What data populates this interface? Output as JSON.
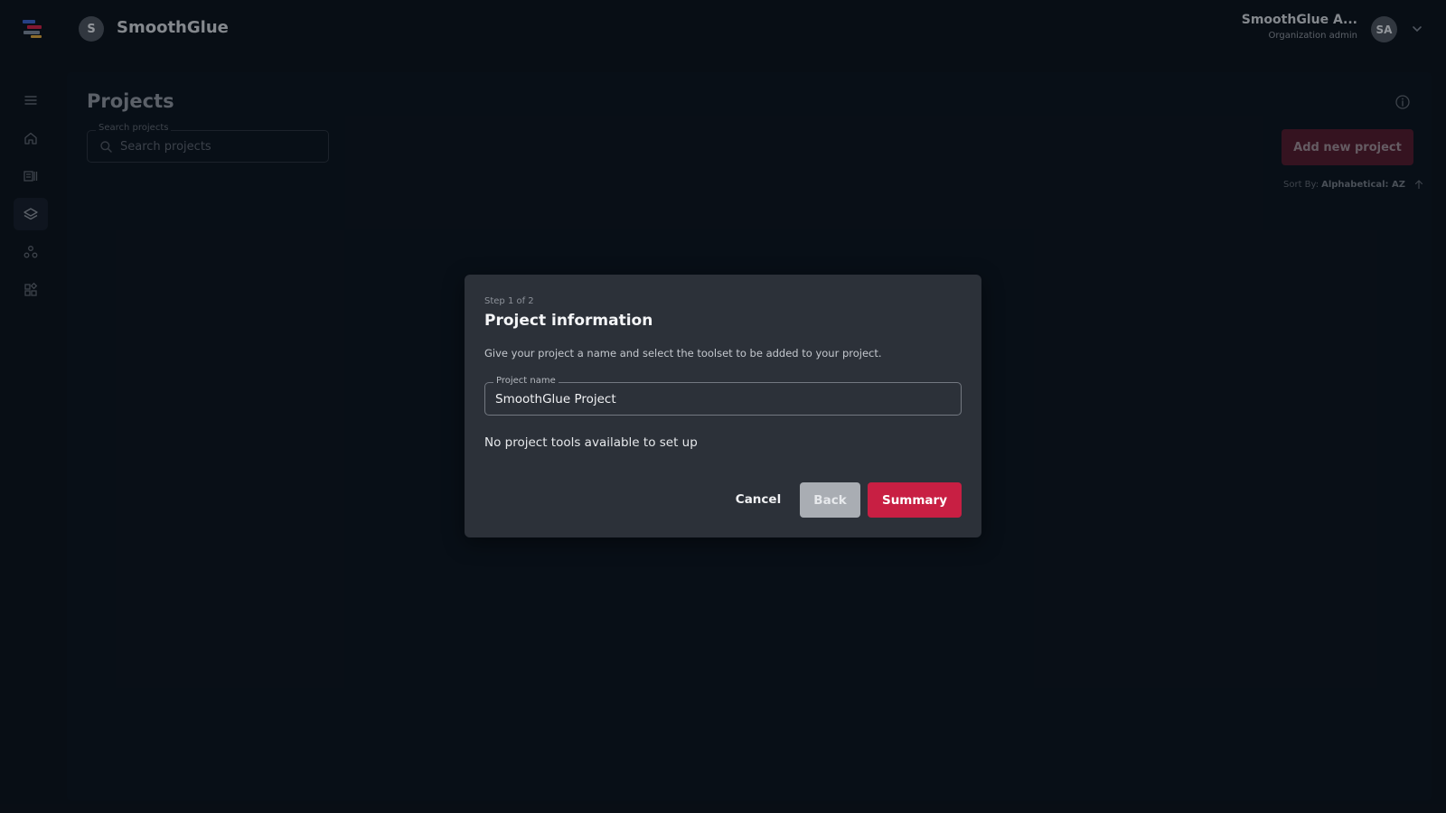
{
  "colors": {
    "background": "#0b1119",
    "panel": "#0c131c",
    "modal": "#2c3139",
    "accent": "#c81f43",
    "accent_muted": "#501a2a",
    "back_button": "#a9adb3"
  },
  "header": {
    "org_initial": "S",
    "org_name": "SmoothGlue",
    "user_name": "SmoothGlue A...",
    "user_role": "Organization admin",
    "user_initials": "SA"
  },
  "sidebar": {
    "items": [
      {
        "icon": "menu-icon"
      },
      {
        "icon": "home-icon"
      },
      {
        "icon": "catalog-icon"
      },
      {
        "icon": "layers-icon",
        "active": true
      },
      {
        "icon": "groups-icon"
      },
      {
        "icon": "apps-icon"
      }
    ]
  },
  "main": {
    "title": "Projects",
    "search": {
      "legend": "Search projects",
      "placeholder": "Search projects"
    },
    "add_button": "Add new project",
    "sort": {
      "label": "Sort By:",
      "value": "Alphabetical: AZ"
    }
  },
  "modal": {
    "step": "Step 1 of 2",
    "title": "Project information",
    "description": "Give your project a name and select the toolset to be added to your project.",
    "name_field": {
      "legend": "Project name",
      "value": "SmoothGlue Project"
    },
    "empty_message": "No project tools available to set up",
    "buttons": {
      "cancel": "Cancel",
      "back": "Back",
      "summary": "Summary"
    }
  }
}
